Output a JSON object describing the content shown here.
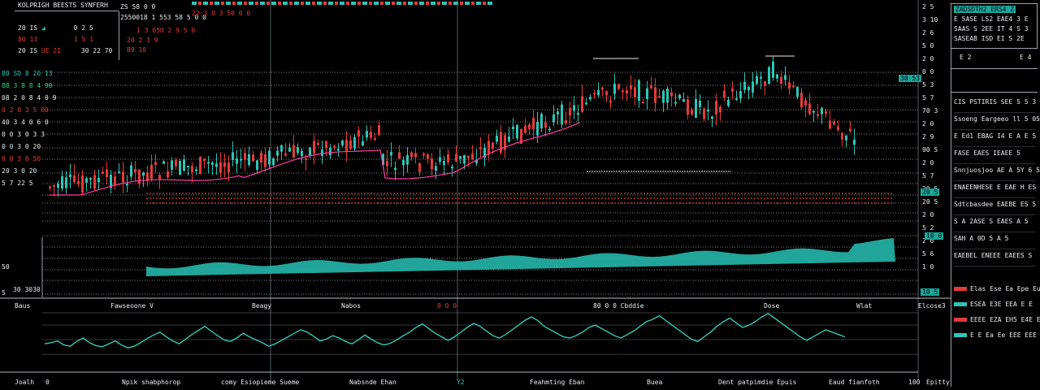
{
  "colors": {
    "bull": "#2ec4b6",
    "bear": "#e23b3b",
    "grid": "#cfd6dc",
    "bg": "#000000",
    "area": "#24b3a8",
    "osc": "#35c6b8",
    "ma": "#ff3aa6"
  },
  "topleft": {
    "title": "KOLPRIGH BEESTS SYNFERH",
    "row1": [
      "20 IS",
      "0 11",
      "0 2 5"
    ],
    "row2": [
      "80 13",
      "1 5 1"
    ],
    "row3": [
      "20 IS",
      "UE 2I",
      "30 22 70"
    ]
  },
  "quote": {
    "line1": "ZS 58 0 0",
    "line2": "2550018  1 553  58 5 0 0",
    "line3": "1 3 050  2 9 5 0",
    "line4": "20 2 1 9",
    "line5": "B9  10"
  },
  "topstrip": {
    "label": "22:3 0 3 50 0 0"
  },
  "right_axis": {
    "ticks": [
      "2 5",
      "3 10",
      "2 6",
      "5 0",
      "2 0",
      "0 0",
      "5 3",
      "5 7",
      "70 3",
      "2 0",
      "2 9",
      "90 5",
      "2 0",
      "5 7",
      "20 5",
      "20 5",
      "2 0",
      "5 2",
      "2 0",
      "5 6",
      "1 0"
    ],
    "tag_top": "30 53",
    "tag_mid": "20 5",
    "tag_low": "10 0",
    "tag_bot": "10 5"
  },
  "left_axis": {
    "rows": [
      "80 SD 8 20 13",
      "88 3 8 8 4 90",
      "08 2 0 8 4 0 9",
      "0 2 0 3 5 00",
      "40 3 4 0 6 0",
      "0 0 3 0 3 3",
      "0 0 3 0 20",
      "0 0 3 0 50",
      "20 3 0 20",
      "5 7 22 5"
    ],
    "row50": "50",
    "row3030": "30 3030",
    "row5": "5"
  },
  "bottom_mid_labels": [
    "Baus",
    "Fawseoone  V",
    "Beagy",
    "Nabos",
    "0 0 0",
    "80 0 0 Cbddie",
    "Dose",
    "Wlat",
    "Elcose3"
  ],
  "bottom_labels": [
    "Joalh",
    "0",
    "Npik  shabphorop",
    "comy  Esiopieme  Sueme",
    "Nabsnde  Ehan",
    "Y2",
    "Feahmting Eban",
    "Buea",
    "Dent  patpimdie  Epuis",
    "Eaud  fianfoth",
    "100",
    "Epitty"
  ],
  "sidebar": {
    "top": [
      "ZADSDTH2 ERS4 Z",
      "E 5ASE LS2 EAE4 3 E",
      "SAAS S 2EE IT 4 S 3",
      "SASEAB ISD EI S 2E"
    ],
    "box": [
      "E 2",
      "E 4"
    ],
    "list": [
      "CIS  PSTIRIS  SEE  5 5 3",
      "Ssoeng  Eargeeo  ll 5  05E S",
      "E Ed1 EBAG  I4 E A E 5",
      "FASE  EAES  IEAEE  5",
      "Snnjuosjoo  AE A 5Y 6 5",
      "ENAEENHESE E EAE H ES 5",
      "Sdtcbasdee  EAEBE ES 5",
      "S A 2ASE  S EAES  A 5",
      "SAH  A 0D  5 A 5",
      "EAEBEL ENEEE  EAEES  S"
    ],
    "colored": [
      {
        "text": "Elas  Ese  Ea  Epe  Eur",
        "color": "red"
      },
      {
        "text": "ESEA  E3E  EEA  E E",
        "color": "teal"
      },
      {
        "text": "EEEE  EZA  EH5  E4E  E",
        "color": "red"
      },
      {
        "text": "E E  Ea Ee  EEE EEE",
        "color": "teal"
      }
    ]
  },
  "osc_data": {
    "type": "line",
    "values": [
      40,
      42,
      45,
      38,
      36,
      44,
      50,
      42,
      37,
      35,
      40,
      45,
      38,
      33,
      36,
      42,
      49,
      55,
      60,
      52,
      45,
      40,
      48,
      56,
      63,
      70,
      62,
      54,
      47,
      44,
      50,
      58,
      52,
      47,
      42,
      36,
      40,
      46,
      52,
      58,
      64,
      60,
      53,
      45,
      48,
      54,
      50,
      44,
      40,
      47,
      55,
      48,
      42,
      38,
      41,
      47,
      54,
      60,
      68,
      74,
      66,
      58,
      52,
      46,
      52,
      60,
      68,
      75,
      70,
      62,
      54,
      50,
      56,
      64,
      72,
      80,
      86,
      80,
      70,
      64,
      58,
      52,
      50,
      54,
      60,
      68,
      72,
      66,
      60,
      54,
      50,
      56,
      62,
      70,
      78,
      82,
      88,
      80,
      72,
      64,
      56,
      48,
      44,
      52,
      60,
      70,
      78,
      84,
      76,
      68,
      72,
      78,
      86,
      92,
      84,
      76,
      68,
      60,
      52,
      46,
      52,
      58,
      64,
      60,
      56,
      52
    ]
  }
}
